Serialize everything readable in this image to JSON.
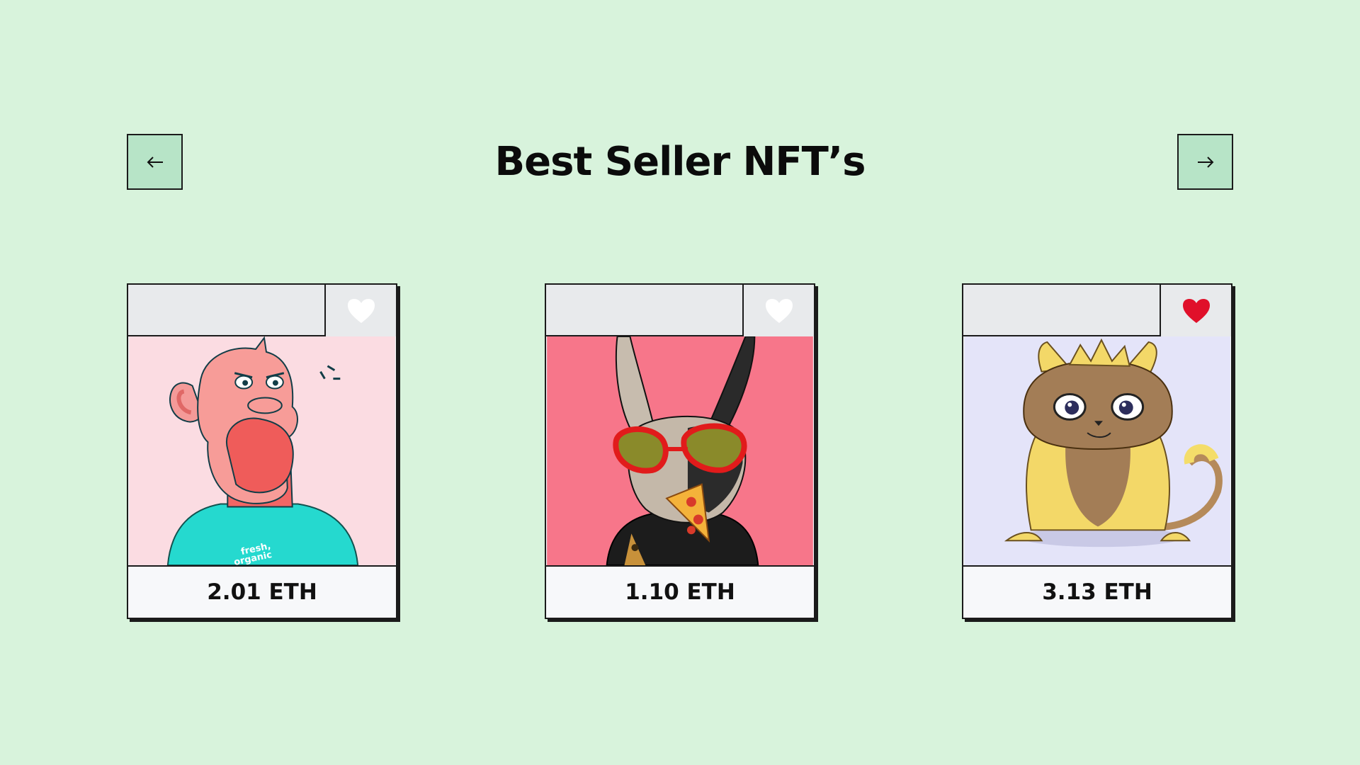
{
  "page": {
    "title": "Best Seller NFT’s"
  },
  "nav": {
    "prev_icon": "arrow-left-icon",
    "next_icon": "arrow-right-icon"
  },
  "colors": {
    "background": "#d8f3dc",
    "nav_button": "#b7e4c7",
    "heart_inactive": "#ffffff",
    "heart_active": "#e0102a"
  },
  "cards": [
    {
      "price": "2.01 ETH",
      "liked": false,
      "art_bg": "#fbdce2"
    },
    {
      "price": "1.10 ETH",
      "liked": false,
      "art_bg": "#f7768a"
    },
    {
      "price": "3.13 ETH",
      "liked": true,
      "art_bg": "#e4e4f9"
    }
  ]
}
